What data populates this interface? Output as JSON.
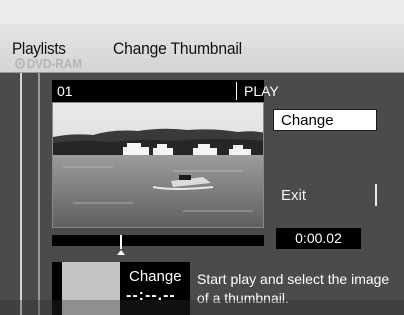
{
  "header": {
    "section": "Playlists",
    "title": "Change Thumbnail",
    "disc": "DVD-RAM"
  },
  "video": {
    "number": "01",
    "status": "PLAY"
  },
  "actions": {
    "change_label": "Change",
    "exit_label": "Exit"
  },
  "playback": {
    "time": "0:00.02"
  },
  "thumbnail": {
    "label": "Change",
    "time": "--:--.--"
  },
  "help": {
    "text": "Start play and select the image of a thumbnail."
  },
  "icons": {
    "disc": "disc-icon",
    "playhead": "playhead-marker-icon"
  }
}
